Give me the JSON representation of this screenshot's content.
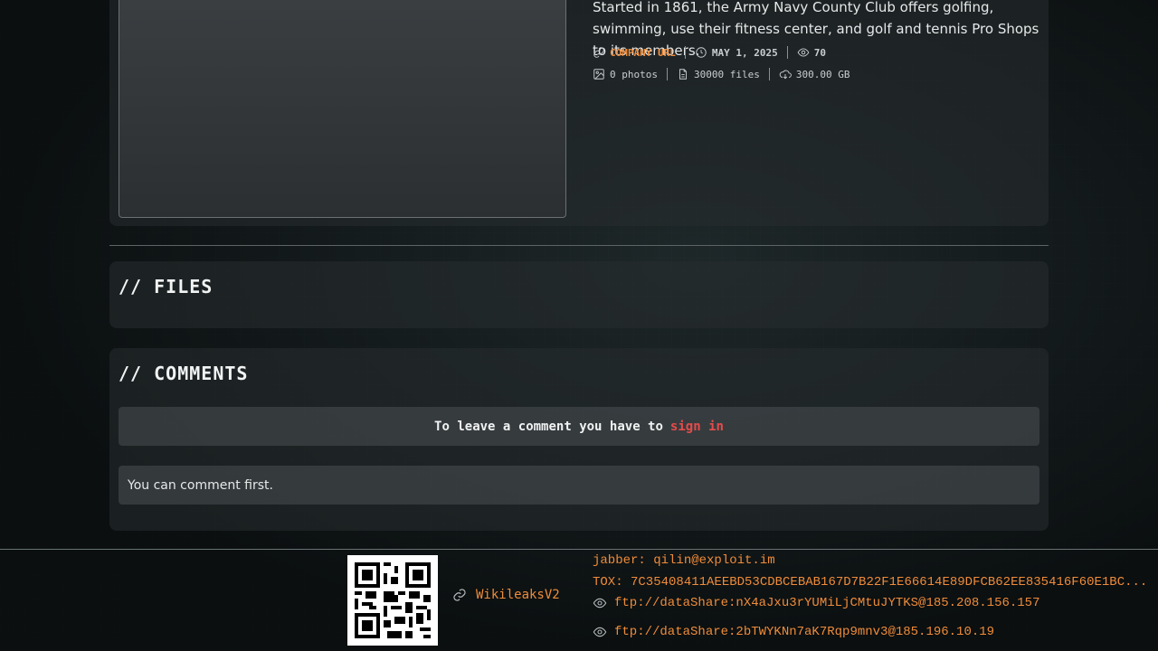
{
  "company": {
    "description": "Started in 1861, the Army Navy County Club offers golfing, swimming, use their fitness center, and golf and tennis Pro Shops to its members.",
    "url_label": "COMPANY URL",
    "date": "MAY 1, 2025",
    "views": "70",
    "photos": "0 photos",
    "files": "30000 files",
    "size": "300.00 GB"
  },
  "sections": {
    "files_title": "// FILES",
    "comments_title": "// COMMENTS"
  },
  "comments": {
    "signin_prompt": "To leave a comment you have to",
    "signin_link": "sign in",
    "empty_text": "You can comment first."
  },
  "footer": {
    "link_label": "WikileaksV2",
    "jabber": "jabber: qilin@exploit.im",
    "tox": "TOX: 7C35408411AEEBD53CDBCEBAB167D7B22F1E66614E89DFCB62EE835416F60E1BC...",
    "ftp1": "ftp://dataShare:nX4aJxu3rYUMiLjCMtuJYTKS@185.208.156.157",
    "ftp2": "ftp://dataShare:2bTWYKNn7aK7Rqp9mnv3@185.196.10.19"
  },
  "colors": {
    "accent_orange": "#ef8c3a",
    "link_red": "#e64b4b"
  }
}
